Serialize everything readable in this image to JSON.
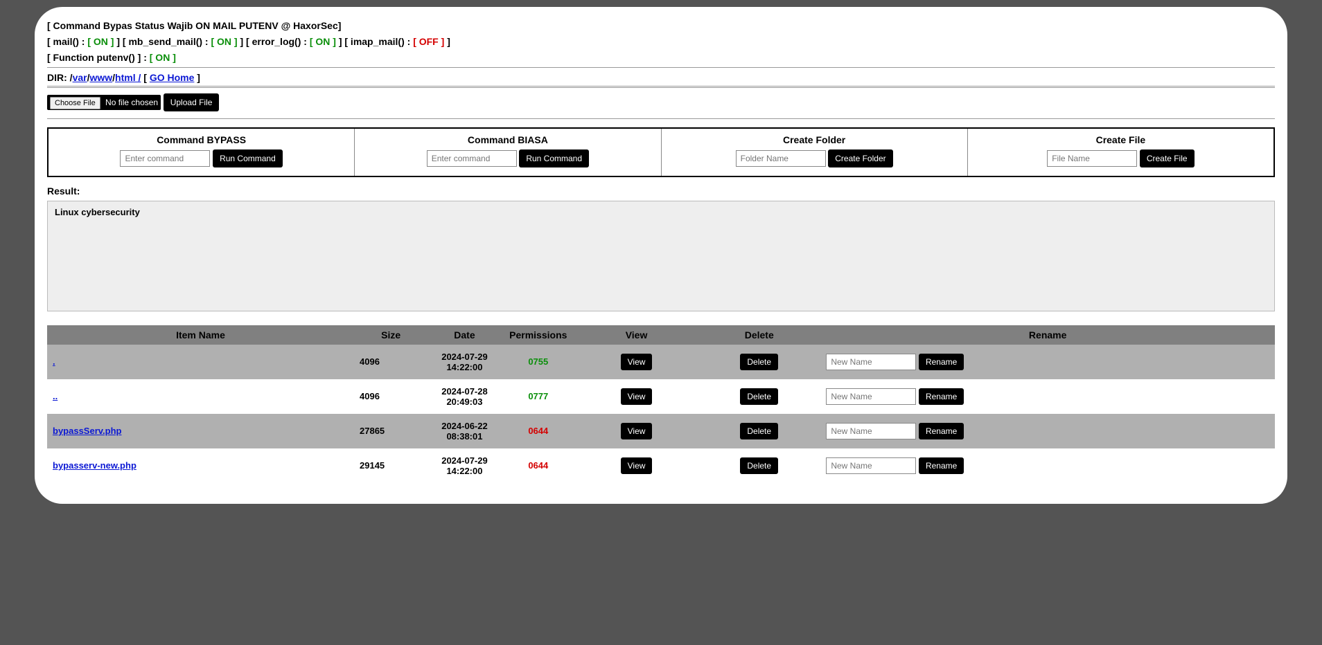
{
  "status": {
    "line1_prefix": "[ Command Bypas Status Wajib ON MAIL PUTENV @ HaxorSec]",
    "mail_label": "[ mail() :",
    "mail_val": "[ ON ]",
    "mbsend_label": "] [ mb_send_mail() :",
    "mbsend_val": "[ ON ]",
    "errorlog_label": "] [ error_log() :",
    "errorlog_val": "[ ON ]",
    "imap_label": "] [ imap_mail() :",
    "imap_val": "[ OFF ]",
    "imap_close": "]",
    "putenv_label": "[ Function putenv() ] :",
    "putenv_val": "[ ON ]"
  },
  "dir": {
    "label": "DIR: ",
    "root": "/",
    "p1": "var",
    "p2": "www",
    "p3": "html /",
    "go_open": "[ ",
    "go": "GO Home",
    "go_close": " ]"
  },
  "upload": {
    "choose": "Choose File",
    "nofile": "No file chosen",
    "btn": "Upload File"
  },
  "panel": {
    "bypass_title": "Command BYPASS",
    "biasa_title": "Command BIASA",
    "cmd_placeholder": "Enter command",
    "run": "Run Command",
    "folder_title": "Create Folder",
    "folder_placeholder": "Folder Name",
    "folder_btn": "Create Folder",
    "file_title": "Create File",
    "file_placeholder": "File Name",
    "file_btn": "Create File"
  },
  "result": {
    "label": "Result:",
    "text": "Linux cybersecurity"
  },
  "table": {
    "headers": {
      "name": "Item Name",
      "size": "Size",
      "date": "Date",
      "perm": "Permissions",
      "view": "View",
      "delete": "Delete",
      "rename": "Rename"
    },
    "buttons": {
      "view": "View",
      "delete": "Delete",
      "rename": "Rename"
    },
    "rename_placeholder": "New Name",
    "rows": [
      {
        "name": ".",
        "size": "4096",
        "date": "2024-07-29 14:22:00",
        "perm": "0755",
        "permClass": "perm-green",
        "rowClass": "grey"
      },
      {
        "name": "..",
        "size": "4096",
        "date": "2024-07-28 20:49:03",
        "perm": "0777",
        "permClass": "perm-green",
        "rowClass": "white"
      },
      {
        "name": "bypassServ.php",
        "size": "27865",
        "date": "2024-06-22 08:38:01",
        "perm": "0644",
        "permClass": "perm-red",
        "rowClass": "grey"
      },
      {
        "name": "bypasserv-new.php",
        "size": "29145",
        "date": "2024-07-29 14:22:00",
        "perm": "0644",
        "permClass": "perm-red",
        "rowClass": "white"
      }
    ]
  }
}
